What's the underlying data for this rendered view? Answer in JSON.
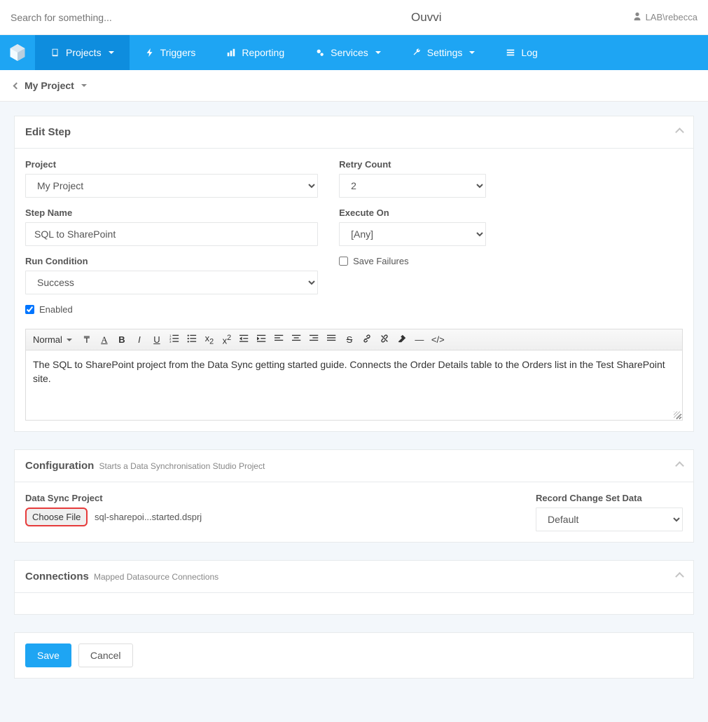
{
  "topbar": {
    "search_placeholder": "Search for something...",
    "brand": "Ouvvi",
    "user_label": "LAB\\rebecca"
  },
  "nav": {
    "projects": "Projects",
    "triggers": "Triggers",
    "reporting": "Reporting",
    "services": "Services",
    "settings": "Settings",
    "log": "Log"
  },
  "breadcrumb": {
    "project": "My Project"
  },
  "editStep": {
    "title": "Edit Step",
    "labels": {
      "project": "Project",
      "step_name": "Step Name",
      "run_condition": "Run Condition",
      "enabled": "Enabled",
      "retry_count": "Retry Count",
      "execute_on": "Execute On",
      "save_failures": "Save Failures"
    },
    "values": {
      "project": "My Project",
      "step_name": "SQL to SharePoint",
      "run_condition": "Success",
      "enabled": true,
      "retry_count": "2",
      "execute_on": "[Any]",
      "save_failures": false
    },
    "editor": {
      "style_select": "Normal",
      "content": "The SQL to SharePoint project from the Data Sync getting started guide. Connects the Order Details table to the Orders list in the Test SharePoint site."
    }
  },
  "configuration": {
    "title": "Configuration",
    "subtitle": "Starts a Data Synchronisation Studio Project",
    "labels": {
      "data_sync_project": "Data Sync Project",
      "choose_file": "Choose File",
      "record_change": "Record Change Set Data"
    },
    "values": {
      "filename": "sql-sharepoi...started.dsprj",
      "record_change": "Default"
    }
  },
  "connections": {
    "title": "Connections",
    "subtitle": "Mapped Datasource Connections"
  },
  "actions": {
    "save": "Save",
    "cancel": "Cancel"
  }
}
